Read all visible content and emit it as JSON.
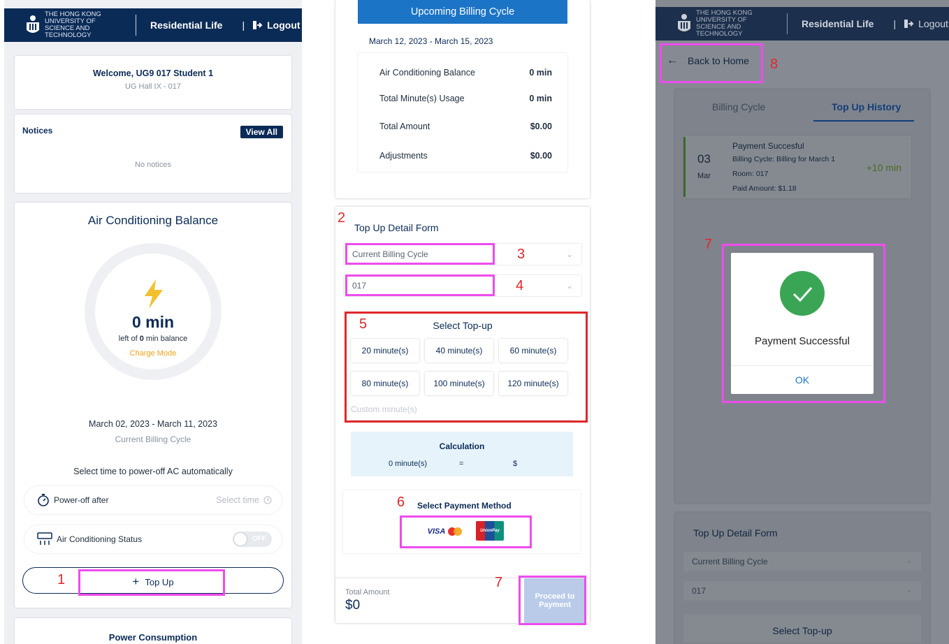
{
  "header": {
    "logo_text": "THE HONG KONG UNIVERSITY OF SCIENCE AND TECHNOLOGY",
    "title": "Residential Life",
    "logout": "Logout"
  },
  "screen1": {
    "welcome": "Welcome, UG9 017 Student 1",
    "hall": "UG Hall IX - 017",
    "notices_title": "Notices",
    "view_all": "View All",
    "no_notices": "No notices",
    "ac_title": "Air Conditioning Balance",
    "balance": "0 min",
    "left_prefix": "left of ",
    "left_value": "0",
    "left_suffix": " min balance",
    "charge_mode": "Charge Mode",
    "cycle_dates": "March 02, 2023 - March 11, 2023",
    "cycle_label": "Current Billing Cycle",
    "poweroff_prompt": "Select time to power-off AC automatically",
    "poweroff_label": "Power-off after",
    "select_time": "Select time",
    "ac_status_label": "Air Conditioning Status",
    "ac_toggle": "OFF",
    "topup_button": "Top Up",
    "power_consumption": "Power Consumption",
    "step_1": "1"
  },
  "screen2": {
    "upcoming_title": "Upcoming Billing Cycle",
    "upcoming_dates": "March 12, 2023 - March 15, 2023",
    "summary": [
      {
        "label": "Air Conditioning Balance",
        "value": "0 min"
      },
      {
        "label": "Total Minute(s) Usage",
        "value": "0 min"
      },
      {
        "label": "Total Amount",
        "value": "$0.00"
      },
      {
        "label": "Adjustments",
        "value": "$0.00"
      }
    ],
    "form_title": "Top Up Detail Form",
    "billing_select": "Current Billing Cycle",
    "room_select": "017",
    "select_topup": "Select Top-up",
    "options": [
      "20 minute(s)",
      "40 minute(s)",
      "60 minute(s)",
      "80 minute(s)",
      "100 minute(s)",
      "120 minute(s)"
    ],
    "custom_placeholder": "Custom minute(s)",
    "calc_title": "Calculation",
    "calc_minutes": "0 minute(s)",
    "calc_eq": "=",
    "calc_amount": "$",
    "payment_title": "Select Payment Method",
    "visa_label": "VISA",
    "unionpay_label": "UnionPay",
    "total_label": "Total Amount",
    "total_value": "$0",
    "proceed": "Proceed to Payment",
    "steps": [
      "2",
      "3",
      "4",
      "5",
      "6",
      "7"
    ]
  },
  "screen3": {
    "back_home": "Back to Home",
    "tab_billing": "Billing Cycle",
    "tab_history": "Top Up History",
    "history": {
      "day": "03",
      "month": "Mar",
      "status": "Payment Succesful",
      "cycle": "Billing Cycle: Billing for March 1",
      "room": "Room: 017",
      "paid": "Paid Amount: $1.18",
      "delta": "+10 min"
    },
    "modal_message": "Payment Successful",
    "modal_ok": "OK",
    "form_title": "Top Up Detail Form",
    "billing_select": "Current Billing Cycle",
    "room_select": "017",
    "select_topup": "Select Top-up",
    "steps": [
      "7",
      "8"
    ]
  },
  "colors": {
    "navy": "#0b2b57",
    "accent_blue": "#1b74c6",
    "success_green": "#3aa655",
    "annotation_magenta": "#ee4cee",
    "annotation_red": "#e0262b",
    "charge_orange": "#f0a21a"
  }
}
